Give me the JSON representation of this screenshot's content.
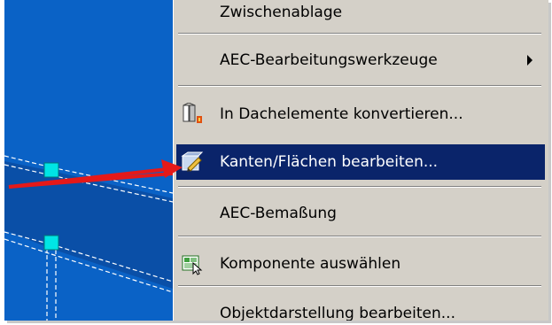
{
  "colors": {
    "canvas_background": "#0a62c6",
    "menu_background": "#d4d0c8",
    "highlight": "#0a246a",
    "grip_color": "#00e5e5",
    "annotation_arrow": "#e51919"
  },
  "menu": {
    "items": [
      {
        "label": "Zwischenablage",
        "icon": null,
        "partial": true
      },
      {
        "label": "AEC-Bearbeitungswerkzeuge",
        "icon": null,
        "submenu": true
      },
      {
        "label": "In Dachelemente konvertieren...",
        "icon": "roof-convert-icon"
      },
      {
        "label": "Kanten/Flächen bearbeiten...",
        "icon": "edit-edges-icon",
        "active": true
      },
      {
        "label": "AEC-Bemaßung",
        "icon": null
      },
      {
        "label": "Komponente auswählen",
        "icon": "select-component-icon"
      },
      {
        "label": "Objektdarstellung bearbeiten...",
        "icon": null
      }
    ]
  },
  "annotation": {
    "description_icon": "red-arrow-icon"
  }
}
